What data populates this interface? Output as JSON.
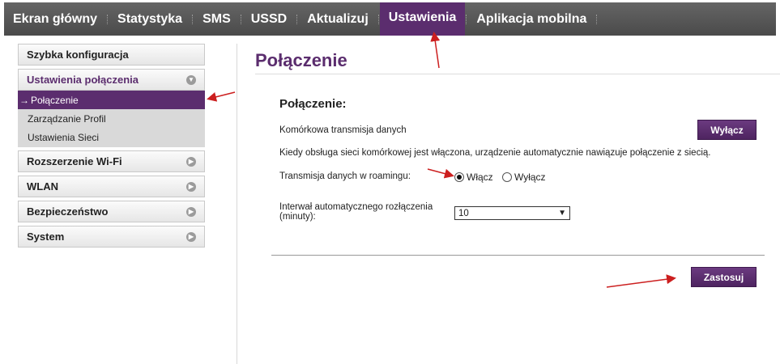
{
  "topnav": {
    "items": [
      "Ekran główny",
      "Statystyka",
      "SMS",
      "USSD",
      "Aktualizuj",
      "Ustawienia",
      "Aplikacja mobilna"
    ],
    "active": "Ustawienia"
  },
  "sidebar": {
    "quick_config": "Szybka konfiguracja",
    "connection_settings": {
      "label": "Ustawienia połączenia",
      "items": [
        "Połączenie",
        "Zarządzanie Profil",
        "Ustawienia Sieci"
      ],
      "active_index": 0
    },
    "sections": [
      "Rozszerzenie Wi-Fi",
      "WLAN",
      "Bezpieczeństwo",
      "System"
    ]
  },
  "main": {
    "page_title": "Połączenie",
    "section_title": "Połączenie:",
    "mobile_data_label": "Komórkowa transmisja danych",
    "mobile_data_button": "Wyłącz",
    "info_text": "Kiedy obsługa sieci komórkowej jest włączona, urządzenie automatycznie nawiązuje połączenie z siecią.",
    "roaming_label": "Transmisja danych w roamingu:",
    "roaming_on": "Włącz",
    "roaming_off": "Wyłącz",
    "roaming_selected": "on",
    "interval_label_line1": "Interwał automatycznego rozłączenia",
    "interval_label_line2": "(minuty):",
    "interval_value": "10",
    "apply_button": "Zastosuj"
  },
  "colors": {
    "accent": "#5b2d6e",
    "nav_bg": "#555555",
    "annotation": "#cc1f1f"
  }
}
